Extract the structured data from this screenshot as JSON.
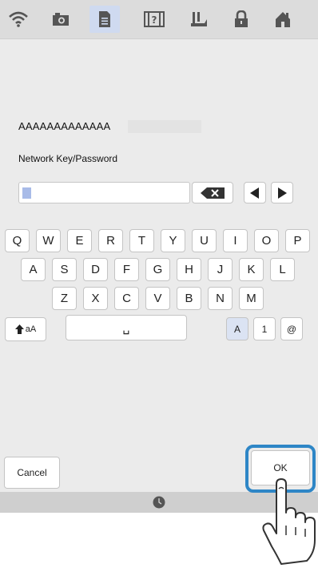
{
  "topbar": {
    "icons": [
      "wifi-icon",
      "camera-icon",
      "document-icon",
      "help-icon",
      "sewing-icon",
      "lock-icon",
      "home-icon"
    ],
    "active_index": 2
  },
  "ssid": "AAAAAAAAAAAAA",
  "network_label": "Network Key/Password",
  "password_value": "",
  "keyboard": {
    "row1": [
      "Q",
      "W",
      "E",
      "R",
      "T",
      "Y",
      "U",
      "I",
      "O",
      "P"
    ],
    "row2": [
      "A",
      "S",
      "D",
      "F",
      "G",
      "H",
      "J",
      "K",
      "L"
    ],
    "row3": [
      "Z",
      "X",
      "C",
      "V",
      "B",
      "N",
      "M"
    ],
    "case_label": "aA",
    "space_symbol": "␣",
    "mode_letters": "A",
    "mode_numbers": "1",
    "mode_symbols": "@"
  },
  "buttons": {
    "cancel": "Cancel",
    "ok": "OK"
  },
  "colors": {
    "highlight": "#2e86c6",
    "active_tab": "#cfdaf0",
    "cursor": "#a8bbe8"
  }
}
